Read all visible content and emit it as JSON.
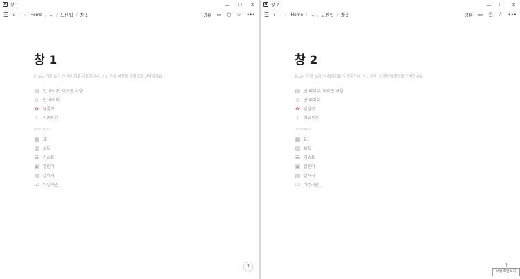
{
  "windows": [
    {
      "title": "창 1",
      "breadcrumb": [
        "Home",
        "...",
        "노션 팁",
        "창 1"
      ],
      "page_title": "창 1"
    },
    {
      "title": "창 2",
      "breadcrumb": [
        "Home",
        "...",
        "노션 팁",
        "창 2"
      ],
      "page_title": "창 2"
    }
  ],
  "toolbar": {
    "share_label": "공유"
  },
  "hint": "Enter 키를 눌러 빈 페이지로 사용하거나, ↑↓ 키를 이용해 템플릿을 선택하세요",
  "start_options": [
    {
      "label": "빈 페이지, 아이콘 사용",
      "icon": "page-icon"
    },
    {
      "label": "빈 페이지",
      "icon": "empty-page-icon"
    },
    {
      "label": "템플릿",
      "icon": "template-icon"
    },
    {
      "label": "가져오기",
      "icon": "import-icon"
    }
  ],
  "database_section_label": "데이터베이스",
  "database_options": [
    {
      "label": "표",
      "icon": "table-icon"
    },
    {
      "label": "보드",
      "icon": "board-icon"
    },
    {
      "label": "리스트",
      "icon": "list-icon"
    },
    {
      "label": "캘린더",
      "icon": "calendar-icon"
    },
    {
      "label": "갤러리",
      "icon": "gallery-icon"
    },
    {
      "label": "타임라인",
      "icon": "timeline-icon"
    }
  ],
  "help_label": "?",
  "tooltip_label": "바탕 화면 보기"
}
